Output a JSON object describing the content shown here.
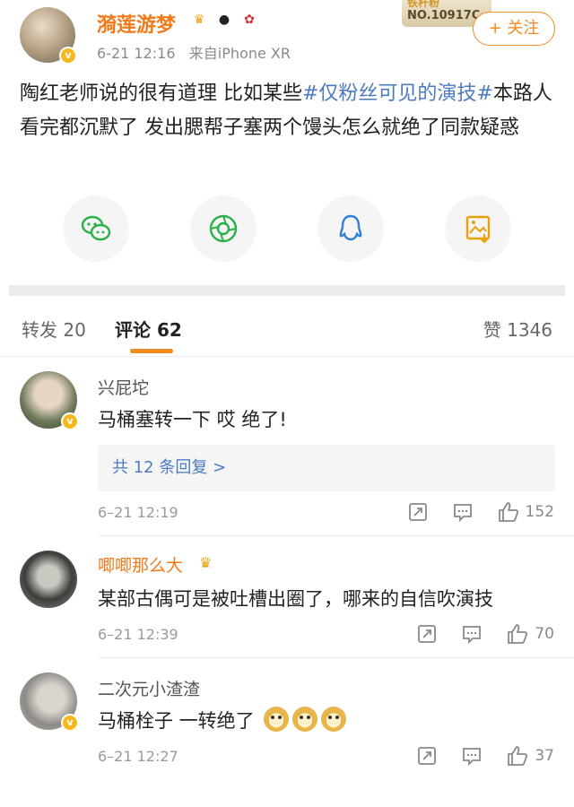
{
  "post": {
    "username": "漪莲游梦",
    "time": "6-21 12:16",
    "source": "来自iPhone XR",
    "fan_card_top": "铁杆粉",
    "fan_card_no": "NO.10917C",
    "follow_label": "+ 关注",
    "text_before": "陶红老师说的很有道理 比如某些",
    "tag": "#仅粉丝可见的演技#",
    "text_after": "本路人看完都沉默了  发出腮帮子塞两个馒头怎么就绝了同款疑惑",
    "share_icons": [
      "wechat-icon",
      "moments-icon",
      "qq-icon",
      "save-image-icon"
    ],
    "colors": {
      "accent": "#f28a23",
      "link": "#4c7bc0",
      "wechat": "#2bb04a",
      "qq": "#2f7fd6",
      "save": "#e8a10c"
    }
  },
  "tabs": {
    "repost": "转发 20",
    "comments": "评论 62",
    "likes": "赞 1346"
  },
  "comments": [
    {
      "name": "兴屁坨",
      "text": "马桶塞转一下 哎 绝了!",
      "reply_summary": "共 12 条回复 >",
      "time": "6–21 12:19",
      "likes": "152"
    },
    {
      "name": "唧唧那么大",
      "text": "某部古偶可是被吐槽出圈了，哪来的自信吹演技",
      "time": "6–21 12:39",
      "likes": "70"
    },
    {
      "name": "二次元小渣渣",
      "text": "马桶栓子 一转绝了",
      "time": "6–21 12:27",
      "likes": "37"
    }
  ]
}
